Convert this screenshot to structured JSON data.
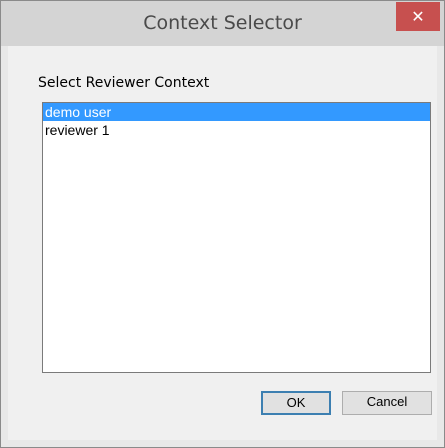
{
  "window": {
    "title": "Context Selector",
    "close_glyph": "✕"
  },
  "dialog": {
    "label": "Select Reviewer Context",
    "list_items": [
      {
        "label": "demo user",
        "selected": true
      },
      {
        "label": "reviewer 1",
        "selected": false
      }
    ]
  },
  "buttons": {
    "ok_label": "OK",
    "cancel_label": "Cancel"
  },
  "colors": {
    "selection": "#3399ff",
    "close_button": "#c7504f",
    "default_button_border": "#3c7fb1"
  }
}
